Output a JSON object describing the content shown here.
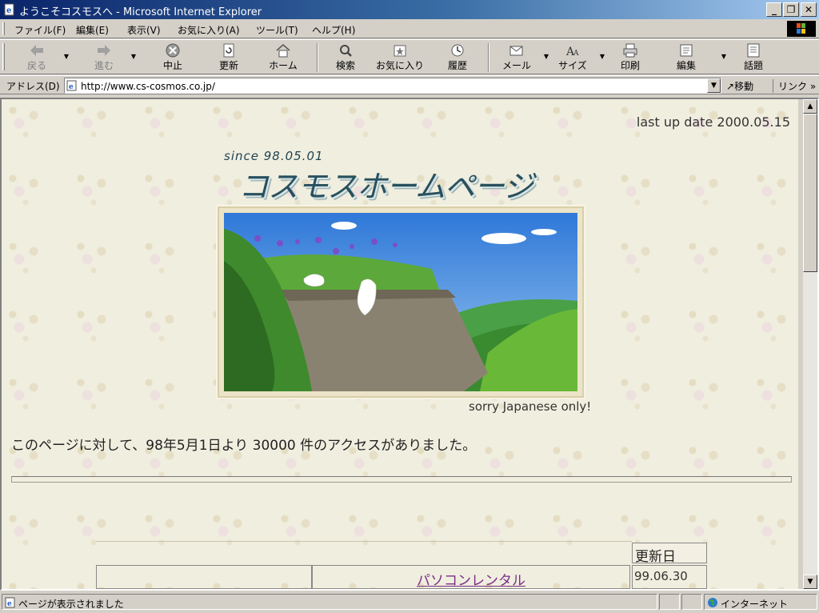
{
  "window": {
    "title": "ようこそコスモスへ - Microsoft Internet Explorer",
    "controls": {
      "minimize": "_",
      "restore": "❐",
      "close": "✕"
    }
  },
  "menu": [
    "ファイル(F)",
    "編集(E)",
    "表示(V)",
    "お気に入り(A)",
    "ツール(T)",
    "ヘルプ(H)"
  ],
  "toolbar": {
    "back": "戻る",
    "forward": "進む",
    "stop": "中止",
    "refresh": "更新",
    "home": "ホーム",
    "search": "検索",
    "favorites": "お気に入り",
    "history": "履歴",
    "mail": "メール",
    "size": "サイズ",
    "print": "印刷",
    "edit": "編集",
    "discuss": "話題"
  },
  "address": {
    "label": "アドレス(D)",
    "url": "http://www.cs-cosmos.co.jp/",
    "go": "移動",
    "links": "リンク"
  },
  "page": {
    "last_update": "last up date 2000.05.15",
    "since": "since 98.05.01",
    "site_title": "コスモスホームページ",
    "sorry": "sorry Japanese only!",
    "counter_text": "このページに対して、98年5月1日より 30000 件のアクセスがありました。",
    "table": {
      "date_header": "更新日",
      "rows": [
        {
          "link": "パソコンレンタル",
          "date": "99.06.30"
        }
      ]
    }
  },
  "status": {
    "message": "ページが表示されました",
    "zone": "インターネット"
  },
  "colors": {
    "title_bar": "#0a246a",
    "page_bg": "#f0eedf",
    "title_text": "#27505e",
    "link": "#7b2d86"
  },
  "icons": [
    "ie-page-icon",
    "back-arrow-icon",
    "forward-arrow-icon",
    "stop-icon",
    "refresh-icon",
    "home-icon",
    "search-icon",
    "favorites-icon",
    "history-icon",
    "mail-icon",
    "font-size-icon",
    "print-icon",
    "edit-icon",
    "discuss-icon",
    "globe-icon"
  ]
}
